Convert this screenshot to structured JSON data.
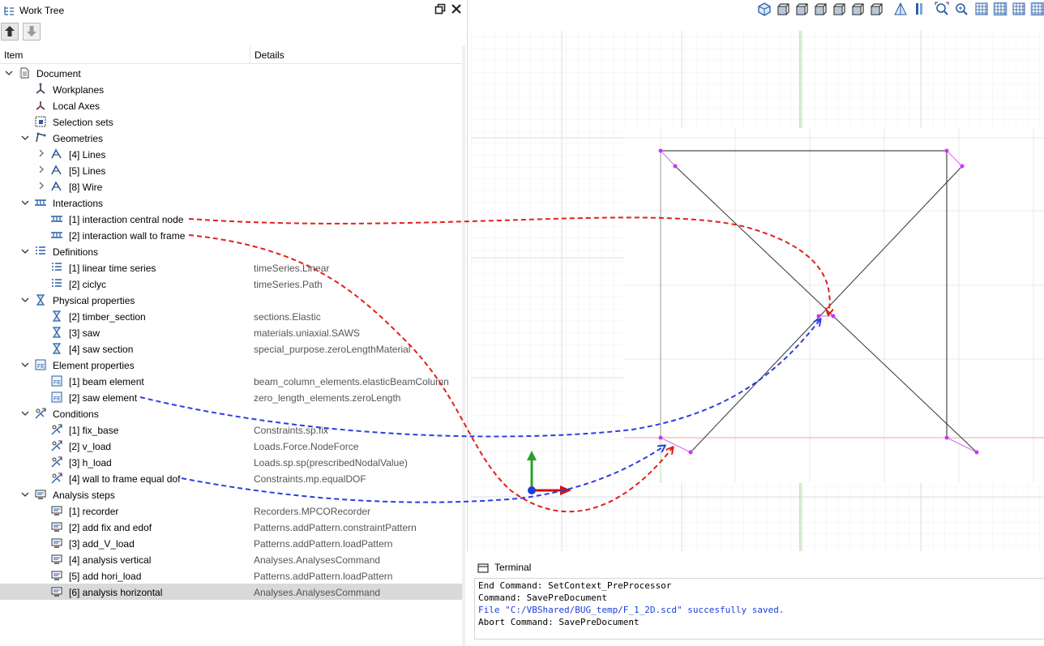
{
  "work_tree": {
    "title": "Work Tree",
    "columns": {
      "item": "Item",
      "details": "Details"
    },
    "rows": [
      {
        "label": "Document",
        "details": "",
        "level": 0,
        "chevron": "down",
        "icon": "document-icon",
        "slug": "document"
      },
      {
        "label": "Workplanes",
        "details": "",
        "level": 1,
        "chevron": "",
        "icon": "workplanes-icon",
        "slug": "workplanes"
      },
      {
        "label": "Local Axes",
        "details": "",
        "level": 1,
        "chevron": "",
        "icon": "local-axes-icon",
        "slug": "local-axes"
      },
      {
        "label": "Selection sets",
        "details": "",
        "level": 1,
        "chevron": "",
        "icon": "selection-sets-icon",
        "slug": "selection-sets"
      },
      {
        "label": "Geometries",
        "details": "",
        "level": 1,
        "chevron": "down",
        "icon": "geometries-icon",
        "slug": "geometries"
      },
      {
        "label": "[4] Lines",
        "details": "",
        "level": 2,
        "chevron": "right",
        "icon": "line-icon",
        "slug": "4-lines"
      },
      {
        "label": "[5] Lines",
        "details": "",
        "level": 2,
        "chevron": "right",
        "icon": "line-icon",
        "slug": "5-lines"
      },
      {
        "label": "[8] Wire",
        "details": "",
        "level": 2,
        "chevron": "right",
        "icon": "line-icon",
        "slug": "8-wire"
      },
      {
        "label": "Interactions",
        "details": "",
        "level": 1,
        "chevron": "down",
        "icon": "interactions-icon",
        "slug": "interactions"
      },
      {
        "label": "[1] interaction central node",
        "details": "",
        "level": 2,
        "chevron": "",
        "icon": "interactions-icon",
        "slug": "1-interaction-central-node"
      },
      {
        "label": "[2] interaction wall to frame",
        "details": "",
        "level": 2,
        "chevron": "",
        "icon": "interactions-icon",
        "slug": "2-interaction-wall-to-frame"
      },
      {
        "label": "Definitions",
        "details": "",
        "level": 1,
        "chevron": "down",
        "icon": "list-icon",
        "slug": "definitions"
      },
      {
        "label": "[1] linear time series",
        "details": "timeSeries.Linear",
        "level": 2,
        "chevron": "",
        "icon": "list-icon",
        "slug": "1-linear-time-series"
      },
      {
        "label": "[2] ciclyc",
        "details": "timeSeries.Path",
        "level": 2,
        "chevron": "",
        "icon": "list-icon",
        "slug": "2-ciclyc"
      },
      {
        "label": "Physical properties",
        "details": "",
        "level": 1,
        "chevron": "down",
        "icon": "physical-property-icon",
        "slug": "physical-properties"
      },
      {
        "label": "[2] timber_section",
        "details": "sections.Elastic",
        "level": 2,
        "chevron": "",
        "icon": "physical-property-icon",
        "slug": "2-timber-section"
      },
      {
        "label": "[3] saw",
        "details": "materials.uniaxial.SAWS",
        "level": 2,
        "chevron": "",
        "icon": "physical-property-icon",
        "slug": "3-saw"
      },
      {
        "label": "[4] saw section",
        "details": "special_purpose.zeroLengthMaterial",
        "level": 2,
        "chevron": "",
        "icon": "physical-property-icon",
        "slug": "4-saw-section"
      },
      {
        "label": "Element properties",
        "details": "",
        "level": 1,
        "chevron": "down",
        "icon": "element-property-icon",
        "slug": "element-properties"
      },
      {
        "label": "[1] beam element",
        "details": "beam_column_elements.elasticBeamColumn",
        "level": 2,
        "chevron": "",
        "icon": "element-property-icon",
        "slug": "1-beam-element"
      },
      {
        "label": "[2] saw element",
        "details": "zero_length_elements.zeroLength",
        "level": 2,
        "chevron": "",
        "icon": "element-property-icon",
        "slug": "2-saw-element"
      },
      {
        "label": "Conditions",
        "details": "",
        "level": 1,
        "chevron": "down",
        "icon": "condition-icon",
        "slug": "conditions"
      },
      {
        "label": "[1] fix_base",
        "details": "Constraints.sp.fix",
        "level": 2,
        "chevron": "",
        "icon": "condition-icon",
        "slug": "1-fix-base"
      },
      {
        "label": "[2] v_load",
        "details": "Loads.Force.NodeForce",
        "level": 2,
        "chevron": "",
        "icon": "condition-icon",
        "slug": "2-v-load"
      },
      {
        "label": "[3] h_load",
        "details": "Loads.sp.sp(prescribedNodalValue)",
        "level": 2,
        "chevron": "",
        "icon": "condition-icon",
        "slug": "3-h-load"
      },
      {
        "label": "[4] wall to frame equal dof",
        "details": "Constraints.mp.equalDOF",
        "level": 2,
        "chevron": "",
        "icon": "condition-icon",
        "slug": "4-wall-to-frame-equal-dof"
      },
      {
        "label": "Analysis steps",
        "details": "",
        "level": 1,
        "chevron": "down",
        "icon": "analysis-step-icon",
        "slug": "analysis-steps"
      },
      {
        "label": "[1] recorder",
        "details": "Recorders.MPCORecorder",
        "level": 2,
        "chevron": "",
        "icon": "analysis-step-icon",
        "slug": "1-recorder"
      },
      {
        "label": "[2] add fix and edof",
        "details": "Patterns.addPattern.constraintPattern",
        "level": 2,
        "chevron": "",
        "icon": "analysis-step-icon",
        "slug": "2-add-fix-and-edof"
      },
      {
        "label": "[3] add_V_load",
        "details": "Patterns.addPattern.loadPattern",
        "level": 2,
        "chevron": "",
        "icon": "analysis-step-icon",
        "slug": "3-add-v-load"
      },
      {
        "label": "[4] analysis vertical",
        "details": "Analyses.AnalysesCommand",
        "level": 2,
        "chevron": "",
        "icon": "analysis-step-icon",
        "slug": "4-analysis-vertical"
      },
      {
        "label": "[5] add hori_load",
        "details": "Patterns.addPattern.loadPattern",
        "level": 2,
        "chevron": "",
        "icon": "analysis-step-icon",
        "slug": "5-add-hori-load"
      },
      {
        "label": "[6] analysis horizontal",
        "details": "Analyses.AnalysesCommand",
        "level": 2,
        "chevron": "",
        "icon": "analysis-step-icon",
        "slug": "6-analysis-horizontal",
        "selected": true
      }
    ]
  },
  "viewport_toolbar": {
    "icons": [
      "view-iso-icon",
      "view-front-icon",
      "view-back-icon",
      "view-left-icon",
      "view-right-icon",
      "view-top-icon",
      "view-bottom-icon",
      "perspective-icon",
      "orthographic-icon",
      "zoom-fit-icon",
      "zoom-window-icon",
      "grid-icon",
      "grid-fine-icon",
      "grid-angle-icon",
      "grid-select-icon"
    ]
  },
  "terminal": {
    "title": "Terminal",
    "lines": [
      {
        "text": "End Command: SetContext_PreProcessor",
        "kind": "normal"
      },
      {
        "text": "Command: SavePreDocument",
        "kind": "normal"
      },
      {
        "text": "File \"C:/VBShared/BUG_temp/F_1_2D.scd\" succesfully saved.",
        "kind": "info"
      },
      {
        "text": "Abort Command: SavePreDocument",
        "kind": "normal"
      }
    ]
  },
  "colors": {
    "accent_blue": "#1a3fd8",
    "annotation_red": "#e0201b",
    "annotation_blue": "#2c3fe0",
    "node_magenta": "#cc33ff",
    "axis_green": "#2aa02a",
    "axis_red": "#cc1111",
    "selection_bg": "#d9d9d9"
  }
}
